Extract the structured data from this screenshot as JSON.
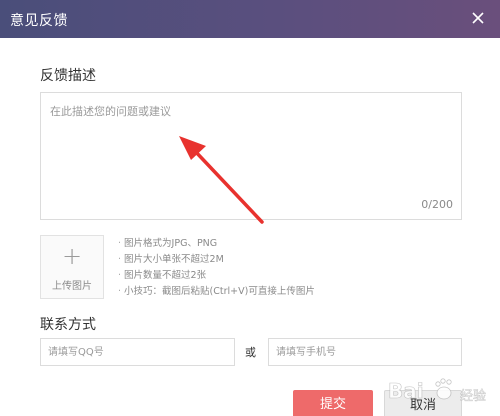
{
  "dialog": {
    "title": "意见反馈",
    "close_icon": "close-icon"
  },
  "feedback": {
    "label": "反馈描述",
    "placeholder": "在此描述您的问题或建议",
    "value": "",
    "counter": "0/200"
  },
  "upload": {
    "plus": "+",
    "label": "上传图片",
    "tips": [
      "图片格式为JPG、PNG",
      "图片大小单张不超过2M",
      "图片数量不超过2张",
      "小技巧：截图后粘贴(Ctrl+V)可直接上传图片"
    ]
  },
  "contact": {
    "label": "联系方式",
    "qq_placeholder": "请填写QQ号",
    "or": "或",
    "phone_placeholder": "请填写手机号"
  },
  "buttons": {
    "submit": "提交",
    "cancel": "取消"
  },
  "colors": {
    "titlebar_start": "#4a4e7a",
    "titlebar_end": "#6a4f7c",
    "submit": "#ee6a6a",
    "annotation_arrow": "#e8322e"
  },
  "watermark": {
    "text": "Bai 经验"
  }
}
